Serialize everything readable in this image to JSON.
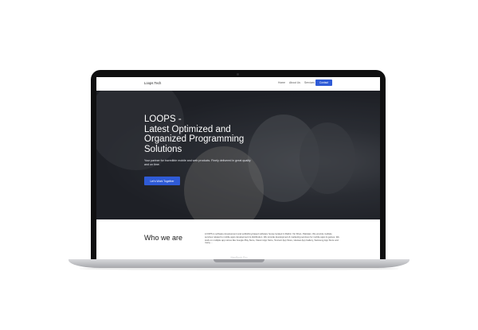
{
  "navbar": {
    "brand": "Loops Tech",
    "links": [
      "Home",
      "About Us",
      "Services"
    ],
    "contact_label": "Contact"
  },
  "hero": {
    "title": "LOOPS -\nLatest Optimized and\nOrganized Programming\nSolutions",
    "subtitle": "Your partner for incredible mobile and web products. Finely delivered in great quality and on time.",
    "cta_label": "Let's Work Together"
  },
  "about": {
    "title": "Who we are",
    "text": "LOOPS is software development and publishing based software house located in Rahim Yar Khan, Pakistan. We provide multiple services related to mobile apps development & distribution. We provide development & marketing services for mobile apps & games. We work on multiple app stores like Google Play Store, Xiaomi App Store, Tencent App Store, Huawei App Gallery, Samsung App Store and many ..."
  },
  "device": {
    "model_label": "MacBook Pro"
  }
}
